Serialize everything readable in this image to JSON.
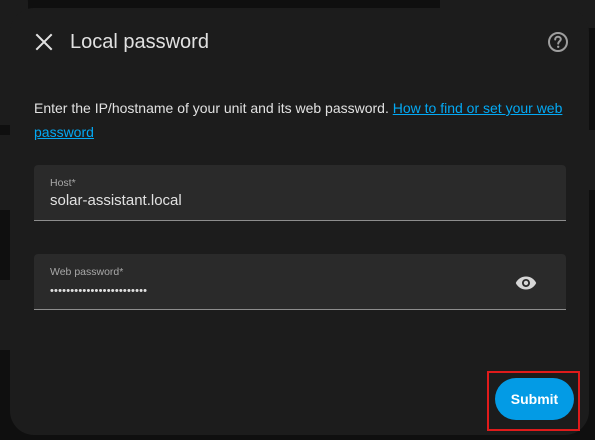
{
  "dialog": {
    "title": "Local password",
    "close_icon": "close-icon",
    "help_icon": "help-circle-icon"
  },
  "description": {
    "text": "Enter the IP/hostname of your unit and its web password. ",
    "link_text": "How to find or set your web password"
  },
  "fields": {
    "host": {
      "label": "Host*",
      "value": "solar-assistant.local"
    },
    "password": {
      "label": "Web password*",
      "value": "••••••••••••••••••••••••",
      "toggle_icon": "eye-icon"
    }
  },
  "actions": {
    "submit_label": "Submit"
  },
  "colors": {
    "dialog_bg": "#1c1c1c",
    "field_bg": "#2a2a2a",
    "link": "#03a9f4",
    "primary_button": "#039be5",
    "highlight_border": "#e01b1b"
  }
}
